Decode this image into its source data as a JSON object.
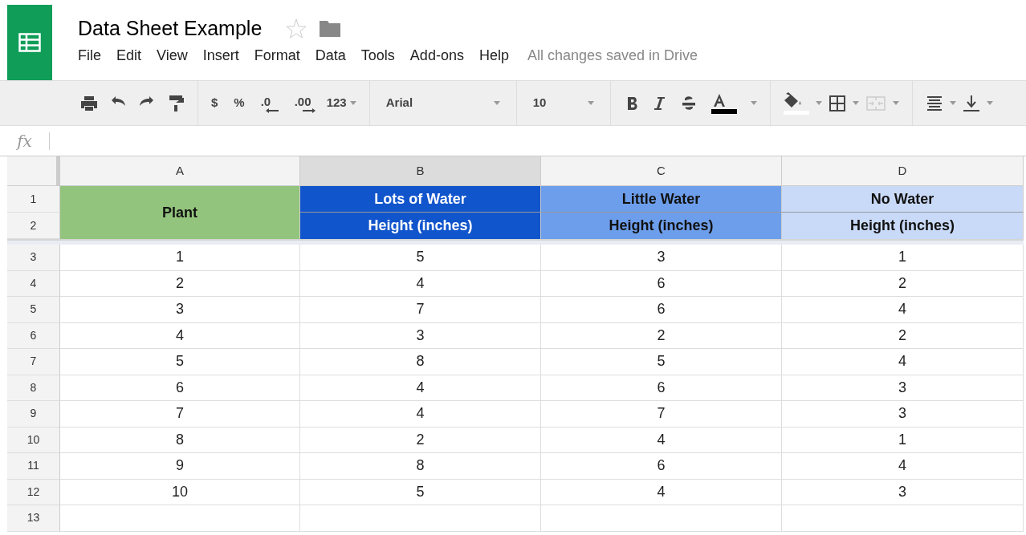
{
  "document": {
    "title": "Data Sheet Example",
    "starred": false
  },
  "menu": [
    "File",
    "Edit",
    "View",
    "Insert",
    "Format",
    "Data",
    "Tools",
    "Add-ons",
    "Help"
  ],
  "save_status": "All changes saved in Drive",
  "toolbar": {
    "currency": "$",
    "percent": "%",
    "decrease_decimals": ".0",
    "increase_decimals": ".00",
    "number_format": "123",
    "font": "Arial",
    "font_size": "10",
    "merge_disabled": true
  },
  "formula_bar": {
    "label": "fx"
  },
  "columns": [
    {
      "label": "A",
      "selected": false
    },
    {
      "label": "B",
      "selected": true
    },
    {
      "label": "C",
      "selected": false
    },
    {
      "label": "D",
      "selected": false
    }
  ],
  "header_rows": [
    "1",
    "2"
  ],
  "header_cells": [
    {
      "lines": [
        "Plant"
      ],
      "color": "#93c47d"
    },
    {
      "lines": [
        "Lots of Water",
        "Height (inches)"
      ],
      "color": "#1155cc"
    },
    {
      "lines": [
        "Little Water",
        "Height (inches)"
      ],
      "color": "#6d9eeb"
    },
    {
      "lines": [
        "No Water",
        "Height (inches)"
      ],
      "color": "#c9daf8"
    }
  ],
  "rows": [
    {
      "number": "3",
      "cells": [
        "1",
        "5",
        "3",
        "1"
      ]
    },
    {
      "number": "4",
      "cells": [
        "2",
        "4",
        "6",
        "2"
      ]
    },
    {
      "number": "5",
      "cells": [
        "3",
        "7",
        "6",
        "4"
      ]
    },
    {
      "number": "6",
      "cells": [
        "4",
        "3",
        "2",
        "2"
      ]
    },
    {
      "number": "7",
      "cells": [
        "5",
        "8",
        "5",
        "4"
      ]
    },
    {
      "number": "8",
      "cells": [
        "6",
        "4",
        "6",
        "3"
      ]
    },
    {
      "number": "9",
      "cells": [
        "7",
        "4",
        "7",
        "3"
      ]
    },
    {
      "number": "10",
      "cells": [
        "8",
        "2",
        "4",
        "1"
      ]
    },
    {
      "number": "11",
      "cells": [
        "9",
        "8",
        "6",
        "4"
      ]
    },
    {
      "number": "12",
      "cells": [
        "10",
        "5",
        "4",
        "3"
      ]
    },
    {
      "number": "13"
    }
  ]
}
